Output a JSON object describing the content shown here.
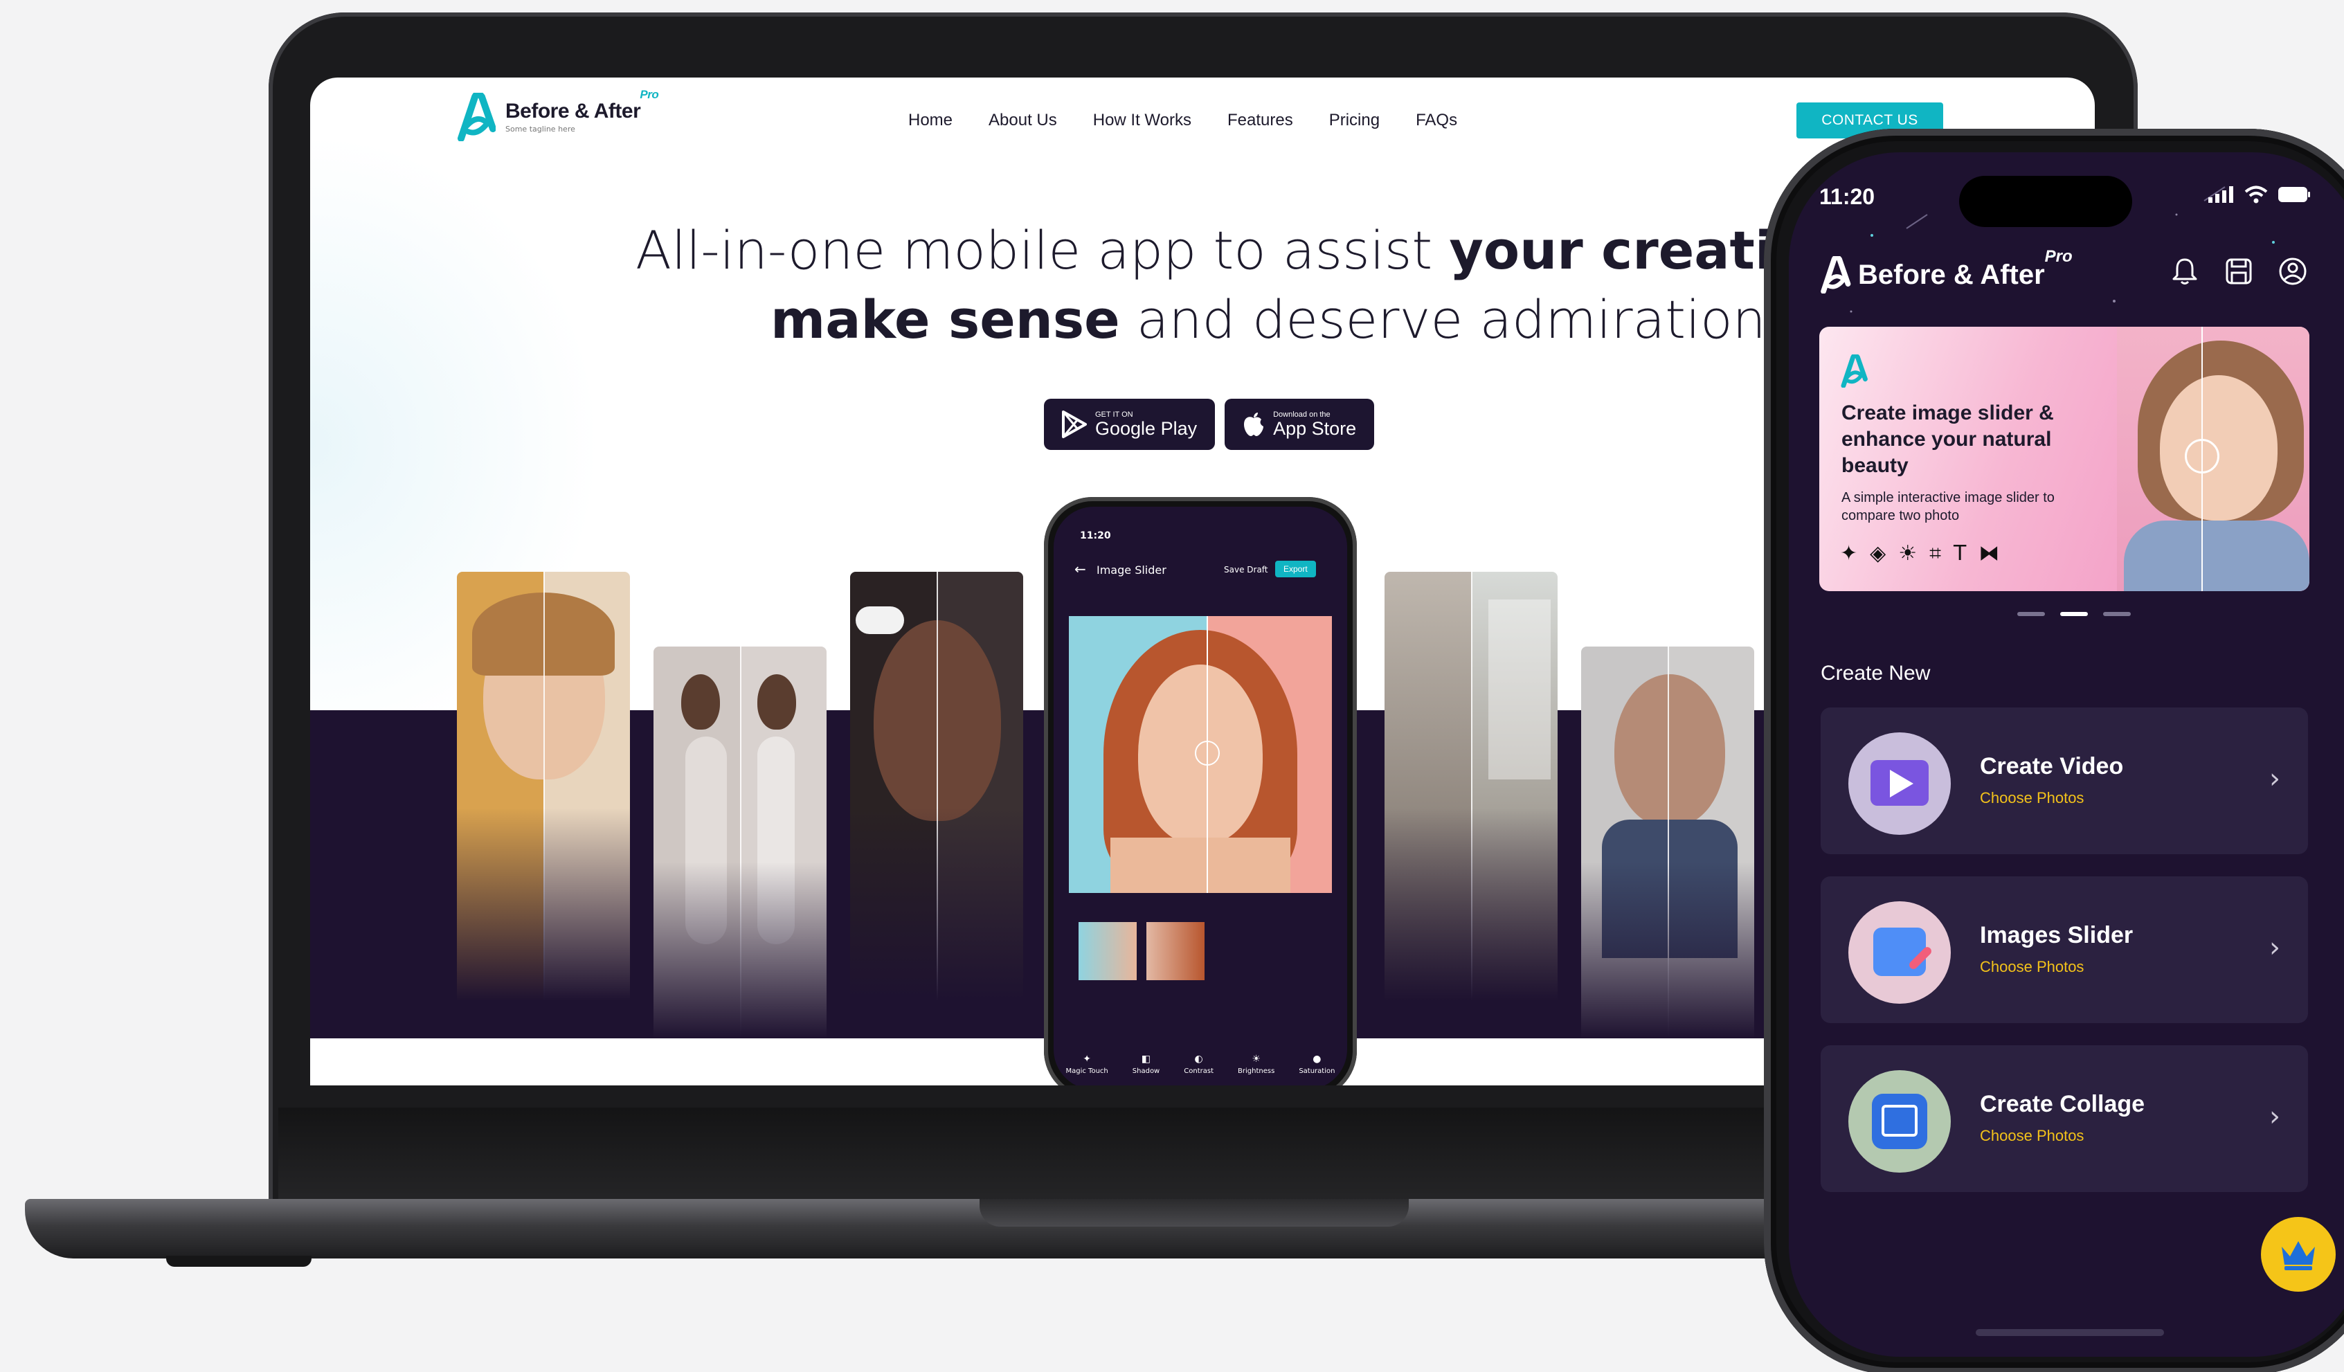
{
  "laptop": {
    "header": {
      "logo_text": "Before & After",
      "logo_pro": "Pro",
      "logo_tagline": "Some tagline here",
      "nav": [
        "Home",
        "About Us",
        "How It Works",
        "Features",
        "Pricing",
        "FAQs"
      ],
      "contact_label": "CONTACT US"
    },
    "hero": {
      "line1_light": "All-in-one mobile app to assist ",
      "line1_bold": "your creativities",
      "line2_bold": "make sense",
      "line2_light": " and deserve admiration"
    },
    "stores": {
      "google_small": "GET IT ON",
      "google_big": "Google Play",
      "apple_small": "Download on the",
      "apple_big": "App Store"
    },
    "mini_phone": {
      "time": "11:20",
      "title": "Image Slider",
      "save_draft": "Save Draft",
      "export": "Export",
      "tools": [
        "Magic Touch",
        "Shadow",
        "Contrast",
        "Brightness",
        "Saturation"
      ]
    }
  },
  "phone": {
    "time": "11:20",
    "logo_text": "Before & After",
    "logo_pro": "Pro",
    "banner": {
      "title": "Create image slider & enhance your natural beauty",
      "subtitle": "A simple interactive image slider to compare two photo"
    },
    "section_title": "Create New",
    "actions": [
      {
        "title": "Create Video",
        "subtitle": "Choose Photos"
      },
      {
        "title": "Images Slider",
        "subtitle": "Choose Photos"
      },
      {
        "title": "Create Collage",
        "subtitle": "Choose Photos"
      }
    ]
  },
  "colors": {
    "accent": "#10b5c3",
    "dark": "#1e1230",
    "card": "#2b2140",
    "highlight": "#f3c21a"
  }
}
